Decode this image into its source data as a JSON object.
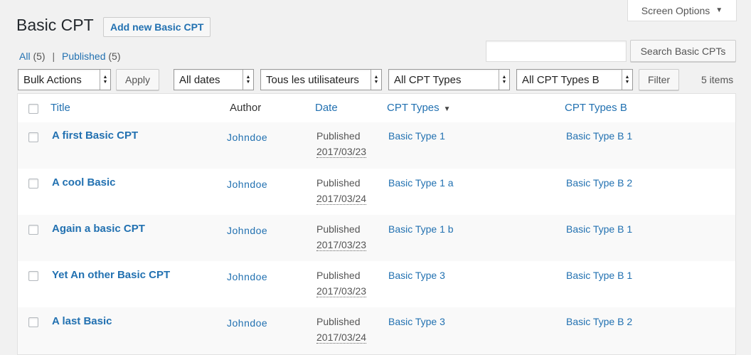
{
  "screen_options": {
    "label": "Screen Options"
  },
  "header": {
    "title": "Basic CPT",
    "add_new": "Add new Basic CPT"
  },
  "views": {
    "all_label": "All",
    "all_count": "(5)",
    "separator": "|",
    "published_label": "Published",
    "published_count": "(5)"
  },
  "search": {
    "value": "",
    "button": "Search Basic CPTs"
  },
  "filters": {
    "bulk_actions": "Bulk Actions",
    "apply": "Apply",
    "dates": "All dates",
    "users": "Tous les utilisateurs",
    "cpt_types": "All CPT Types",
    "cpt_types_b": "All CPT Types B",
    "filter": "Filter",
    "items": "5 items"
  },
  "table": {
    "columns": {
      "title": "Title",
      "author": "Author",
      "date": "Date",
      "cpt_types": "CPT Types",
      "cpt_types_b": "CPT Types B"
    },
    "rows": [
      {
        "title": "A first Basic CPT",
        "author": "Johndoe",
        "status": "Published",
        "date": "2017/03/23",
        "type": "Basic Type 1",
        "type_b": "Basic Type B 1"
      },
      {
        "title": "A cool Basic",
        "author": "Johndoe",
        "status": "Published",
        "date": "2017/03/24",
        "type": "Basic Type 1 a",
        "type_b": "Basic Type B 2"
      },
      {
        "title": "Again a basic CPT",
        "author": "Johndoe",
        "status": "Published",
        "date": "2017/03/23",
        "type": "Basic Type 1 b",
        "type_b": "Basic Type B 1"
      },
      {
        "title": "Yet An other Basic CPT",
        "author": "Johndoe",
        "status": "Published",
        "date": "2017/03/23",
        "type": "Basic Type 3",
        "type_b": "Basic Type B 1"
      },
      {
        "title": "A last Basic",
        "author": "Johndoe",
        "status": "Published",
        "date": "2017/03/24",
        "type": "Basic Type 3",
        "type_b": "Basic Type B 2"
      }
    ]
  },
  "colors": {
    "link": "#2271b1",
    "background": "#f1f1f1",
    "table_alt_row": "#f9f9f9"
  }
}
